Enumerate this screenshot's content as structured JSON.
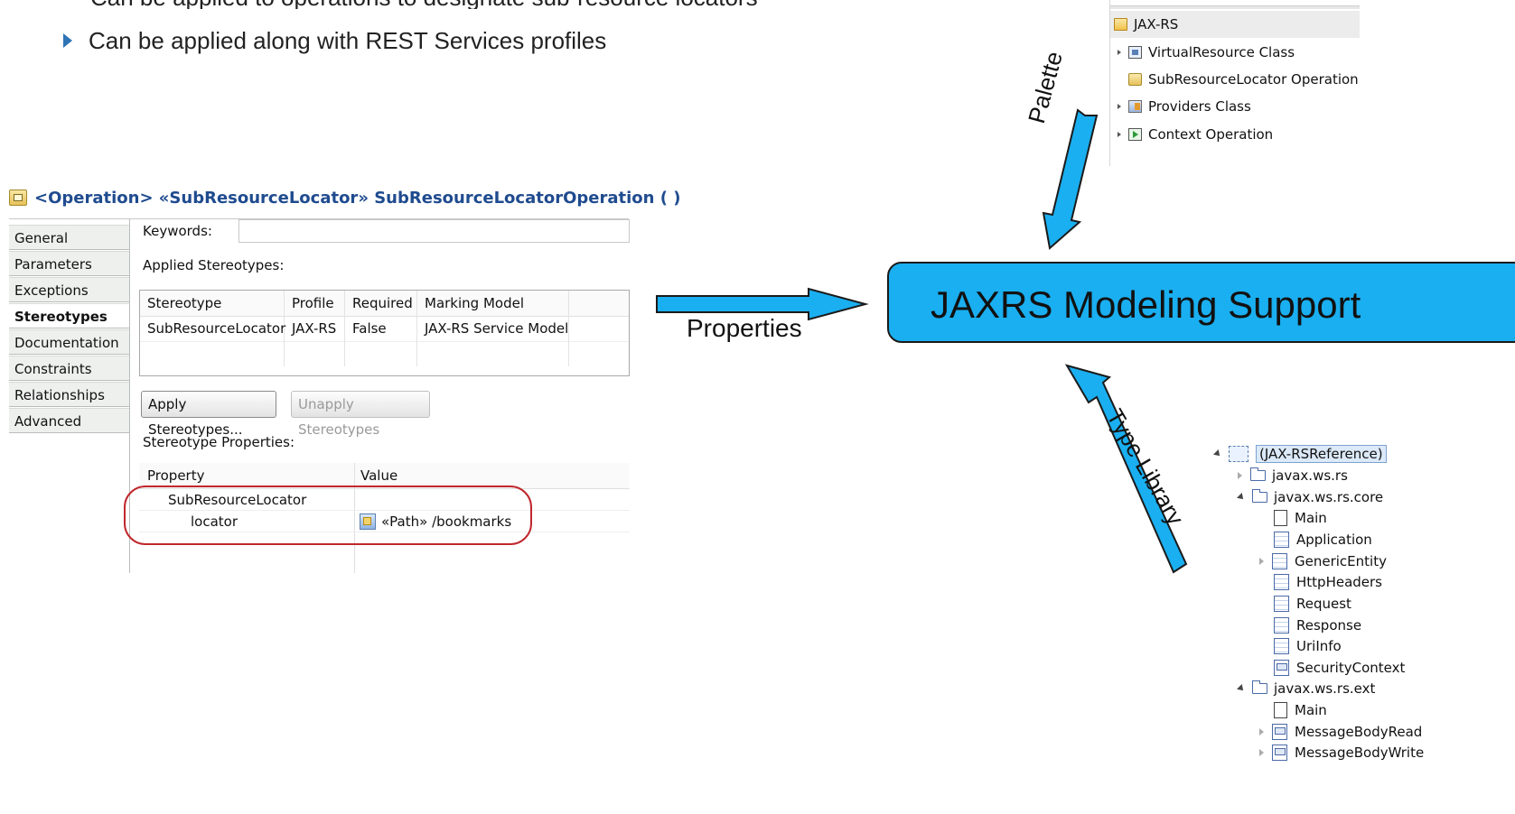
{
  "slide": {
    "bullet_partial": "Can be applied to operations to designate sub-resource locators",
    "bullet": "Can be applied along with REST Services profiles"
  },
  "properties_panel": {
    "title": "<Operation> «SubResourceLocator» SubResourceLocatorOperation ( )",
    "tabs": [
      "General",
      "Parameters",
      "Exceptions",
      "Stereotypes",
      "Documentation",
      "Constraints",
      "Relationships",
      "Advanced"
    ],
    "active_tab": "Stereotypes",
    "keywords_label": "Keywords:",
    "keywords_value": "",
    "applied_stereotypes_label": "Applied Stereotypes:",
    "stereotype_table": {
      "headers": [
        "Stereotype",
        "Profile",
        "Required",
        "Marking Model"
      ],
      "rows": [
        [
          "SubResourceLocator",
          "JAX-RS",
          "False",
          "JAX-RS Service Model"
        ]
      ]
    },
    "apply_button": "Apply Stereotypes...",
    "unapply_button": "Unapply Stereotypes",
    "stereotype_properties_label": "Stereotype Properties:",
    "property_table": {
      "headers": [
        "Property",
        "Value"
      ],
      "group": "SubResourceLocator",
      "property": "locator",
      "value": "«Path» /bookmarks"
    },
    "highlight_color": "#c0282d"
  },
  "arrows": {
    "properties": "Properties",
    "palette": "Palette",
    "type_library": "Type Library",
    "color": "#1aaff0"
  },
  "center_box": {
    "label": "JAXRS Modeling Support",
    "color": "#1aaff0"
  },
  "palette": {
    "header": "JAX-RS",
    "items": [
      "VirtualResource Class",
      "SubResourceLocator Operation",
      "Providers Class",
      "Context Operation"
    ]
  },
  "type_library": {
    "root": "(JAX-RSReference)",
    "packages": [
      {
        "name": "javax.ws.rs",
        "expanded": false
      },
      {
        "name": "javax.ws.rs.core",
        "expanded": true,
        "children": [
          "Main",
          "Application",
          "GenericEntity",
          "HttpHeaders",
          "Request",
          "Response",
          "UriInfo",
          "SecurityContext"
        ]
      },
      {
        "name": "javax.ws.rs.ext",
        "expanded": true,
        "children": [
          "Main",
          "MessageBodyRead",
          "MessageBodyWrite"
        ]
      }
    ]
  }
}
